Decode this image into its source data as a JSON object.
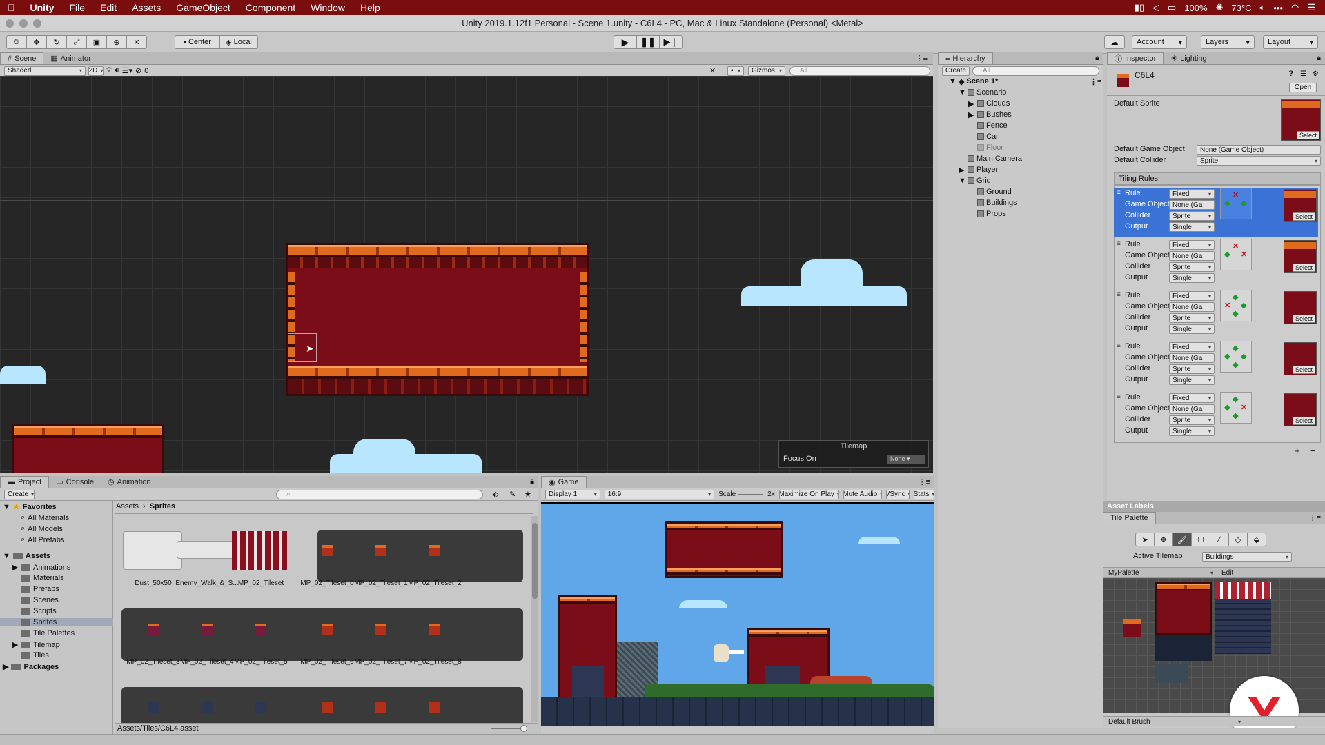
{
  "menubar": {
    "apple": "",
    "items": [
      "Unity",
      "File",
      "Edit",
      "Assets",
      "GameObject",
      "Component",
      "Window",
      "Help"
    ],
    "battery": "100%",
    "temp": "73°C"
  },
  "window": {
    "title": "Unity 2019.1.12f1 Personal - Scene 1.unity - C6L4 - PC, Mac & Linux Standalone (Personal) <Metal>"
  },
  "toolbar": {
    "pivot": "Center",
    "space": "Local",
    "account": "Account",
    "layers": "Layers",
    "layout": "Layout"
  },
  "scene": {
    "tabs": [
      "Scene",
      "Animator"
    ],
    "shading": "Shaded",
    "mode2d": "2D",
    "hidden_count": "0",
    "gizmos": "Gizmos",
    "search_placeholder": "All",
    "overlay_title": "Tilemap",
    "focus_label": "Focus On",
    "focus_value": "None"
  },
  "hierarchy": {
    "tab": "Hierarchy",
    "create": "Create",
    "search_placeholder": "All",
    "scene_name": "Scene 1*",
    "items": [
      {
        "label": "Scenario",
        "level": 1,
        "expand": "open"
      },
      {
        "label": "Clouds",
        "level": 2,
        "expand": "closed"
      },
      {
        "label": "Bushes",
        "level": 2,
        "expand": "closed"
      },
      {
        "label": "Fence",
        "level": 2,
        "expand": "none"
      },
      {
        "label": "Car",
        "level": 2,
        "expand": "none"
      },
      {
        "label": "Floor",
        "level": 2,
        "expand": "none",
        "disabled": true
      },
      {
        "label": "Main Camera",
        "level": 1,
        "expand": "none"
      },
      {
        "label": "Player",
        "level": 1,
        "expand": "closed"
      },
      {
        "label": "Grid",
        "level": 1,
        "expand": "open"
      },
      {
        "label": "Ground",
        "level": 2,
        "expand": "none"
      },
      {
        "label": "Buildings",
        "level": 2,
        "expand": "none"
      },
      {
        "label": "Props",
        "level": 2,
        "expand": "none"
      }
    ]
  },
  "inspector": {
    "tabs": [
      "Inspector",
      "Lighting"
    ],
    "asset_name": "C6L4",
    "open_btn": "Open",
    "default_sprite_label": "Default Sprite",
    "select": "Select",
    "default_go_label": "Default Game Object",
    "default_go_value": "None (Game Object)",
    "default_collider_label": "Default Collider",
    "default_collider_value": "Sprite",
    "tiling_rules": "Tiling Rules",
    "rule_labels": [
      "Rule",
      "Game Object",
      "Collider",
      "Output"
    ],
    "rules": [
      {
        "rule": "Fixed",
        "go": "None (Ga",
        "collider": "Sprite",
        "output": "Single"
      },
      {
        "rule": "Fixed",
        "go": "None (Ga",
        "collider": "Sprite",
        "output": "Single"
      },
      {
        "rule": "Fixed",
        "go": "None (Ga",
        "collider": "Sprite",
        "output": "Single"
      },
      {
        "rule": "Fixed",
        "go": "None (Ga",
        "collider": "Sprite",
        "output": "Single"
      },
      {
        "rule": "Fixed",
        "go": "None (Ga",
        "collider": "Sprite",
        "output": "Single"
      }
    ],
    "add": "+",
    "remove": "−",
    "asset_labels": "Asset Labels"
  },
  "project": {
    "tabs": [
      "Project",
      "Console",
      "Animation"
    ],
    "create": "Create",
    "breadcrumb": [
      "Assets",
      "Sprites"
    ],
    "favorites": "Favorites",
    "fav_items": [
      "All Materials",
      "All Models",
      "All Prefabs"
    ],
    "assets": "Assets",
    "asset_folders": [
      "Animations",
      "Materials",
      "Prefabs",
      "Scenes",
      "Scripts",
      "Sprites",
      "Tile Palettes",
      "Tilemap",
      "Tiles"
    ],
    "packages": "Packages",
    "row1": [
      "Dust_50x50",
      "Enemy_Walk_&_S...",
      "MP_02_Tileset",
      "MP_02_Tileset_0",
      "MP_02_Tileset_1",
      "MP_02_Tileset_2"
    ],
    "row2": [
      "MP_02_Tileset_3",
      "MP_02_Tileset_4",
      "MP_02_Tileset_5",
      "MP_02_Tileset_6",
      "MP_02_Tileset_7",
      "MP_02_Tileset_8"
    ],
    "path": "Assets/Tiles/C6L4.asset"
  },
  "game": {
    "tab": "Game",
    "display": "Display 1",
    "aspect": "16:9",
    "scale_label": "Scale",
    "scale_value": "2x",
    "maximize": "Maximize On Play",
    "mute": "Mute Audio",
    "vsync": "VSync",
    "stats": "Stats"
  },
  "palette": {
    "tab": "Tile Palette",
    "active_tilemap_label": "Active Tilemap",
    "active_tilemap_value": "Buildings",
    "palette_name": "MyPalette",
    "edit": "Edit",
    "brush": "Default Brush"
  },
  "colors": {
    "menubar": "#7a0d0d",
    "selection": "#3a72d6",
    "building": "#7b0d18",
    "brick": "#e06a1e",
    "sky": "#5fa7e8",
    "cloud": "#b9e6ff"
  }
}
